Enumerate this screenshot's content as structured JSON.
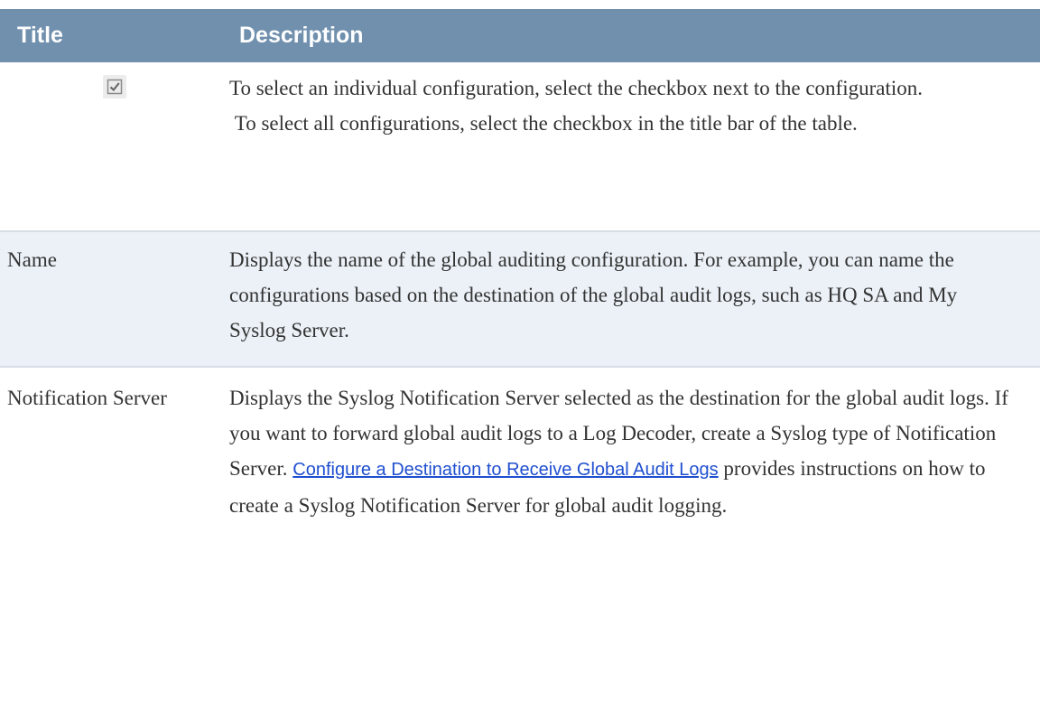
{
  "table": {
    "headers": {
      "title": "Title",
      "description": "Description"
    },
    "rows": [
      {
        "title_icon": "checkbox-checked-icon",
        "description_paragraphs": [
          "To select an individual configuration, select the checkbox next to the configuration.",
          " To select all configurations, select the checkbox in the title bar of the table."
        ]
      },
      {
        "title": "Name",
        "description": "Displays the name of the global auditing configuration. For example, you can name the configurations based on the destination of the global audit logs, such as HQ SA and My Syslog Server."
      },
      {
        "title": "Notification Server",
        "description_before_link": "Displays the Syslog Notification Server selected as the destination for the global audit logs. If you want to forward global audit logs to a Log Decoder, create a Syslog type of Notification Server. ",
        "link_text": "Configure a Destination to Receive Global Audit Logs",
        "description_after_link": " provides instructions on how to create a Syslog Notification Server for global audit logging."
      }
    ]
  },
  "colors": {
    "header_bg": "#7090ae",
    "header_text": "#ffffff",
    "alt_row_bg": "#ebf1f7",
    "link": "#1f4fd0"
  }
}
